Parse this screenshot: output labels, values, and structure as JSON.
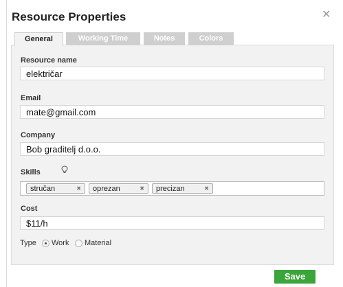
{
  "dialog": {
    "title": "Resource Properties",
    "close_glyph": "✕"
  },
  "tabs": [
    {
      "label": "General",
      "active": true
    },
    {
      "label": "Working Time",
      "active": false
    },
    {
      "label": "Notes",
      "active": false
    },
    {
      "label": "Colors",
      "active": false
    }
  ],
  "form": {
    "resource_name": {
      "label": "Resource name",
      "value": "električar"
    },
    "email": {
      "label": "Email",
      "value": "mate@gmail.com"
    },
    "company": {
      "label": "Company",
      "value": "Bob graditelj d.o.o."
    },
    "skills": {
      "label": "Skills",
      "icon": "lightbulb-icon",
      "tags": [
        "stručan",
        "oprezan",
        "precizan"
      ],
      "remove_glyph": "✖"
    },
    "cost": {
      "label": "Cost",
      "value": "$11/h"
    },
    "type": {
      "label": "Type",
      "options": [
        {
          "label": "Work",
          "selected": true
        },
        {
          "label": "Material",
          "selected": false
        }
      ]
    }
  },
  "footer": {
    "save_label": "Save"
  },
  "colors": {
    "save_button": "#3aa53a",
    "panel": "#f2f2f2",
    "inactive_tab": "#cfcfcf"
  }
}
